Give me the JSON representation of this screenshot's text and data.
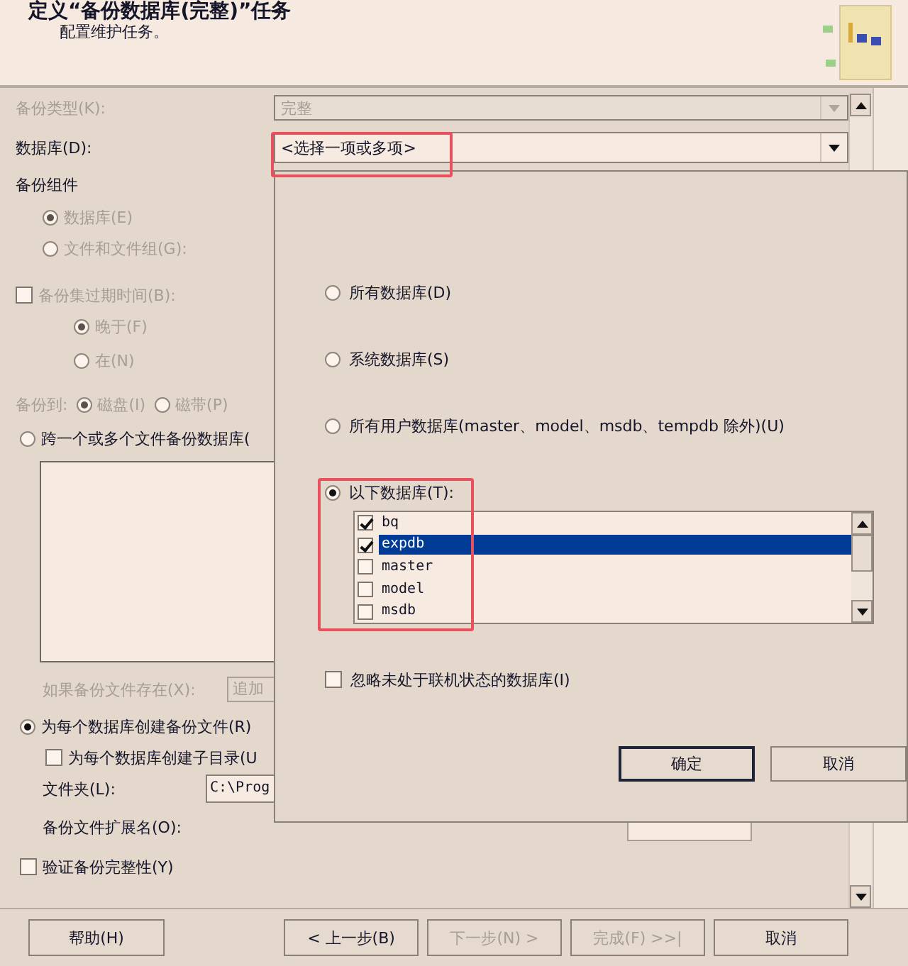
{
  "header": {
    "title": "定义“备份数据库(完整)”任务",
    "subtitle": "配置维护任务。"
  },
  "backup_type": {
    "label": "备份类型(K):",
    "value": "完整",
    "disabled": true
  },
  "database": {
    "label": "数据库(D):",
    "value": "<选择一项或多项>"
  },
  "components": {
    "label": "备份组件",
    "options": [
      {
        "label": "数据库(E)",
        "selected": true,
        "disabled": true
      },
      {
        "label": "文件和文件组(G):",
        "selected": false,
        "disabled": true
      }
    ]
  },
  "expiry": {
    "label": "备份集过期时间(B):",
    "checked": false,
    "disabled": true,
    "options": [
      {
        "label": "晚于(F)",
        "selected": true,
        "disabled": true
      },
      {
        "label": "在(N)",
        "selected": false,
        "disabled": true
      }
    ]
  },
  "backup_to": {
    "label": "备份到:",
    "disabled": true,
    "options": [
      {
        "label": "磁盘(I)",
        "selected": true,
        "disabled": true
      },
      {
        "label": "磁带(P)",
        "selected": false,
        "disabled": true
      }
    ]
  },
  "span_files": {
    "label": "跨一个或多个文件备份数据库(",
    "selected": false
  },
  "if_exists": {
    "label": "如果备份文件存在(X):",
    "value": "追加",
    "disabled": true
  },
  "per_database": {
    "label": "为每个数据库创建备份文件(R)",
    "selected": true
  },
  "subdirectory": {
    "label": "为每个数据库创建子目录(U",
    "checked": false
  },
  "folder": {
    "label": "文件夹(L):",
    "value": "C:\\Prog"
  },
  "extension": {
    "label": "备份文件扩展名(O):"
  },
  "verify": {
    "label": "验证备份完整性(Y)",
    "checked": false
  },
  "footer_buttons": [
    {
      "label": "帮助(H)",
      "disabled": false
    },
    {
      "label": "< 上一步(B)",
      "disabled": false
    },
    {
      "label": "下一步(N) >",
      "disabled": true
    },
    {
      "label": "完成(F) >>|",
      "disabled": true
    },
    {
      "label": "取消",
      "disabled": false
    }
  ],
  "popup": {
    "options": [
      {
        "label": "所有数据库(D)",
        "selected": false
      },
      {
        "label": "系统数据库(S)",
        "selected": false
      },
      {
        "label": "所有用户数据库(master、model、msdb、tempdb 除外)(U)",
        "selected": false
      },
      {
        "label": "以下数据库(T):",
        "selected": true
      }
    ],
    "databases": [
      {
        "name": "bq",
        "checked": true,
        "selected": false
      },
      {
        "name": "expdb",
        "checked": true,
        "selected": true
      },
      {
        "name": "master",
        "checked": false,
        "selected": false
      },
      {
        "name": "model",
        "checked": false,
        "selected": false
      },
      {
        "name": "msdb",
        "checked": false,
        "selected": false
      }
    ],
    "ignore_offline": {
      "label": "忽略未处于联机状态的数据库(I)",
      "checked": false
    },
    "buttons": [
      {
        "label": "确定",
        "default": true
      },
      {
        "label": "取消",
        "default": false
      }
    ]
  }
}
